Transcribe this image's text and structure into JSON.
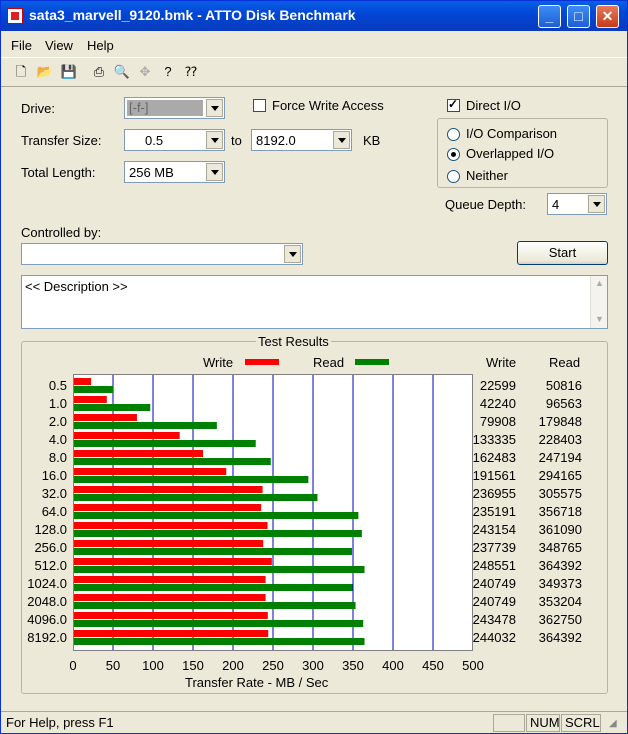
{
  "window": {
    "title": "sata3_marvell_9120.bmk - ATTO Disk Benchmark"
  },
  "menu": {
    "file": "File",
    "view": "View",
    "help": "Help"
  },
  "toolbar": {
    "icons": [
      "new-file-icon",
      "open-folder-icon",
      "save-icon",
      "print-icon",
      "print-preview-icon",
      "move-icon",
      "help-icon",
      "context-help-icon"
    ]
  },
  "form": {
    "drive_label": "Drive:",
    "drive_value": "[-f-]",
    "force_write_label": "Force Write Access",
    "direct_io_label": "Direct I/O",
    "transfer_size_label": "Transfer Size:",
    "transfer_from": "0.5",
    "to_label": "to",
    "transfer_to": "8192.0",
    "kb_label": "KB",
    "total_length_label": "Total Length:",
    "total_length_value": "256 MB",
    "io_comparison_label": "I/O Comparison",
    "overlapped_io_label": "Overlapped I/O",
    "neither_label": "Neither",
    "queue_depth_label": "Queue Depth:",
    "queue_depth_value": "4",
    "controlled_by_label": "Controlled by:",
    "controlled_by_value": "",
    "start_label": "Start",
    "description_text": "<< Description >>"
  },
  "results": {
    "title": "Test Results",
    "write_column": "Write",
    "read_column": "Read"
  },
  "chart_data": {
    "type": "bar",
    "orientation": "horizontal",
    "categories": [
      "0.5",
      "1.0",
      "2.0",
      "4.0",
      "8.0",
      "16.0",
      "32.0",
      "64.0",
      "128.0",
      "256.0",
      "512.0",
      "1024.0",
      "2048.0",
      "4096.0",
      "8192.0"
    ],
    "series": [
      {
        "name": "Write",
        "color": "#ff0000",
        "values": [
          22599,
          42240,
          79908,
          133335,
          162483,
          191561,
          236955,
          235191,
          243154,
          237739,
          248551,
          240749,
          240749,
          243478,
          244032
        ]
      },
      {
        "name": "Read",
        "color": "#008000",
        "values": [
          50816,
          96563,
          179848,
          228403,
          247194,
          294165,
          305575,
          356718,
          361090,
          348765,
          364392,
          349373,
          353204,
          362750,
          364392
        ]
      }
    ],
    "xlabel": "Transfer Rate - MB / Sec",
    "x_ticks": [
      "0",
      "50",
      "100",
      "150",
      "200",
      "250",
      "300",
      "350",
      "400",
      "450",
      "500"
    ],
    "xlim": [
      0,
      500
    ],
    "grid": true,
    "legend": "top"
  },
  "statusbar": {
    "help_text": "For Help, press F1",
    "num": "NUM",
    "scrl": "SCRL"
  }
}
